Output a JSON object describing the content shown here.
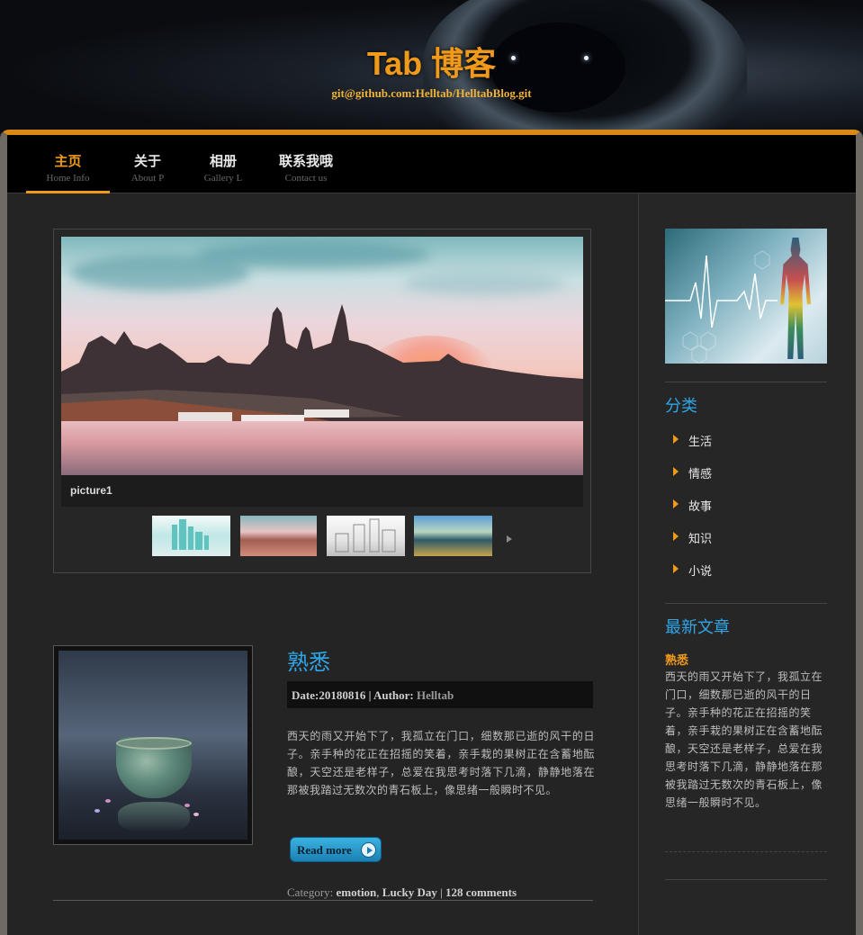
{
  "header": {
    "title": "Tab 博客",
    "subtitle": "git@github.com:Helltab/HelltabBlog.git"
  },
  "nav": {
    "items": [
      {
        "zh": "主页",
        "en": "Home Info",
        "active": true
      },
      {
        "zh": "关于",
        "en": "About P"
      },
      {
        "zh": "相册",
        "en": "Gallery L"
      },
      {
        "zh": "联系我哦",
        "en": "Contact us"
      }
    ]
  },
  "slider": {
    "caption": "picture1",
    "thumbnails": [
      "thumb-city-teal",
      "thumb-city-sunset",
      "thumb-city-sketch",
      "thumb-city-harbor"
    ]
  },
  "post": {
    "title": "熟悉",
    "meta": {
      "date_label": "Date:",
      "date": "20180816",
      "sep": " | ",
      "author_label": "Author: ",
      "author": "Helltab"
    },
    "body": "西天的雨又开始下了，我孤立在门口，细数那已逝的风干的日子。亲手种的花正在招摇的笑着，亲手栽的果树正在含蓄地酝酿，天空还是老样子，总爱在我思考时落下几滴，静静地落在那被我踏过无数次的青石板上，像思绪一般瞬时不见。",
    "read_more": "Read more",
    "footer": {
      "category_label": "Category: ",
      "category_1": "emotion",
      "comma": ", ",
      "category_2": "Lucky Day",
      "sep": " | ",
      "comments": "128 comments"
    }
  },
  "sidebar": {
    "categories_heading": "分类",
    "categories": [
      "生活",
      "情感",
      "故事",
      "知识",
      "小说"
    ],
    "recent_heading": "最新文章",
    "recent_title": "熟悉",
    "recent_body": "西天的雨又开始下了，我孤立在门口，细数那已逝的风干的日子。亲手种的花正在招摇的笑着，亲手栽的果树正在含蓄地酝酿，天空还是老样子，总爱在我思考时落下几滴，静静地落在那被我踏过无数次的青石板上，像思绪一般瞬时不见。"
  },
  "colors": {
    "accent_orange": "#f09a1c",
    "link_blue": "#2ea6e8",
    "background": "#242424"
  }
}
